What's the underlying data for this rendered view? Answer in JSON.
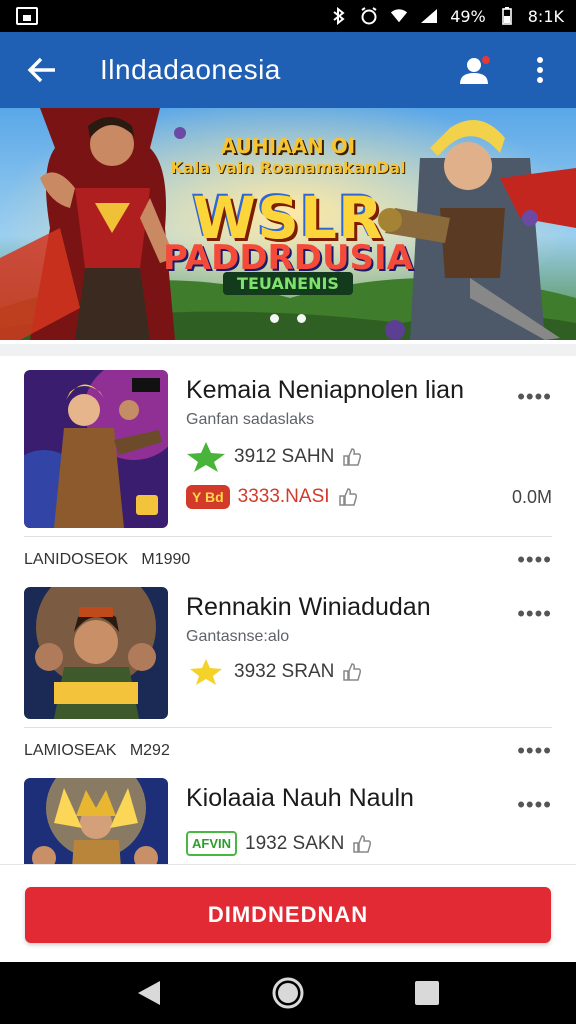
{
  "status_bar": {
    "battery_percent": "49%",
    "time": "8:1K"
  },
  "app_bar": {
    "title": "Ilndadaonesia"
  },
  "banner": {
    "line1": "AUHIAAN OI",
    "line2": "Kala vain RoanamakanDal",
    "line3": "WSLR",
    "line4": "PADDRDUSIA",
    "line5": "TEUANENIS"
  },
  "games": [
    {
      "name": "Kemaia Neniapnolen lian",
      "category": "Ganfan sadaslaks",
      "stat1": "3912 SAHN",
      "stat2": "3333.NASI",
      "stat2_badge": "Y Bd",
      "size": "0.0M"
    },
    {
      "name": "Rennakin Winiadudan",
      "category": "Gantasnse:alo",
      "stat1": "3932 SRAN"
    },
    {
      "name": "Kiolaaia Nauh Nauln",
      "category": "",
      "stat1": "1932 SAKN",
      "badge": "AFVIN"
    }
  ],
  "separators": [
    {
      "left": "LANIDOSEOK",
      "right": "M1990"
    },
    {
      "left": "LAMIOSEAK",
      "right": "M292"
    }
  ],
  "cta": {
    "label": "DIMDNEDNAN"
  }
}
